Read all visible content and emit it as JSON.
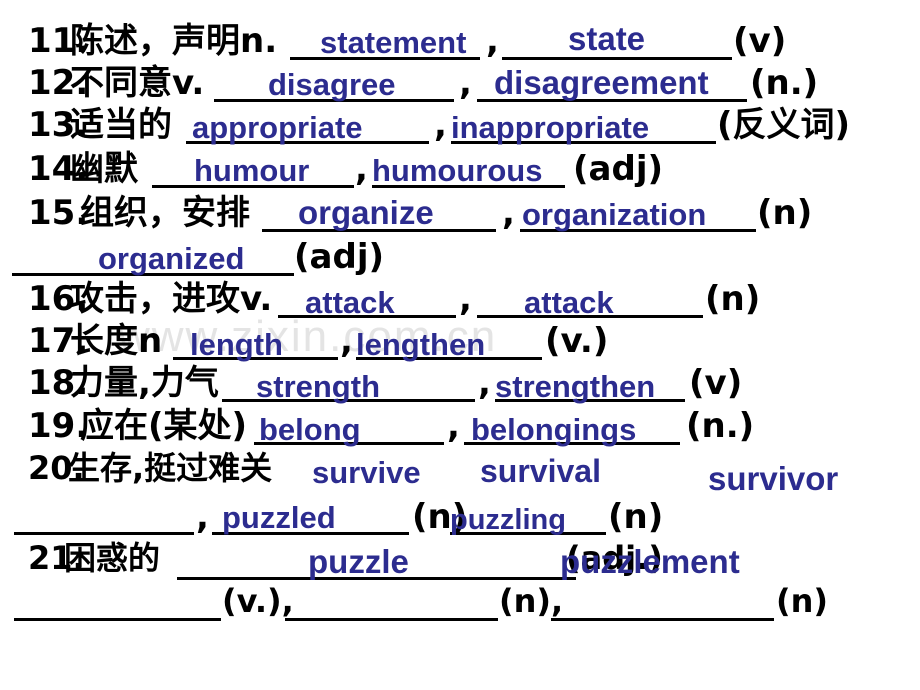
{
  "slide": {
    "background_color": "#ffffff",
    "answer_color": "#2c2c8f",
    "text_color": "#000000",
    "watermark": "www.zixin.com.cn",
    "watermark_color": "#e4e4e4"
  },
  "entries": [
    {
      "number": "11.",
      "prompt": "陈述，声明n.",
      "answers": [
        "statement",
        "state"
      ],
      "tags": [
        "(v)"
      ],
      "separator": ","
    },
    {
      "number": "12.",
      "prompt": "不同意v.",
      "answers": [
        "disagree",
        "disagreement"
      ],
      "tags": [
        "(n.)"
      ],
      "separator": ","
    },
    {
      "number": "13.",
      "prompt": "适当的",
      "answers": [
        "appropriate",
        "inappropriate"
      ],
      "tags": [
        "(反义词)"
      ],
      "separator": ","
    },
    {
      "number": "14.",
      "prompt": "幽默",
      "answers": [
        "humour",
        "humourous"
      ],
      "tags": [
        "(adj)"
      ],
      "separator": ","
    },
    {
      "number": "15.",
      "prompt": "组织，安排",
      "answers": [
        "organize",
        "organization",
        "organized"
      ],
      "tags": [
        "(n)",
        "(adj)"
      ],
      "separator": ","
    },
    {
      "number": "16.",
      "prompt": "攻击，进攻v.",
      "answers": [
        "attack",
        "attack"
      ],
      "tags": [
        "(n)"
      ],
      "separator": ","
    },
    {
      "number": "17.",
      "prompt": "长度n",
      "answers": [
        "length",
        "lengthen"
      ],
      "tags": [
        "(v.)"
      ],
      "separator": ","
    },
    {
      "number": "18.",
      "prompt": "力量,力气",
      "answers": [
        "strength",
        "strengthen"
      ],
      "tags": [
        "(v)"
      ],
      "separator": ","
    },
    {
      "number": "19.",
      "prompt": "应在(某处)",
      "answers": [
        "belong",
        "belongings"
      ],
      "tags": [
        "(n.)"
      ],
      "separator": ","
    },
    {
      "number": "20.",
      "prompt": "生存,挺过难关",
      "answers": [
        "survive",
        "survival",
        "survivor",
        "puzzled",
        "puzzling"
      ],
      "tags": [
        "(n)",
        "(n)"
      ],
      "separator": ","
    },
    {
      "number": "21.",
      "prompt": "困惑的",
      "answers": [
        "puzzle",
        "puzzlement"
      ],
      "tags": [
        "(adj.)",
        "(v.),",
        "(n),",
        "(n)"
      ],
      "separator": ","
    }
  ],
  "line11": {
    "num": "11.",
    "prompt": "陈述，声明n.",
    "a1": "statement",
    "comma": ",",
    "a2": "state",
    "tag": "(v)"
  },
  "line12": {
    "num": "12.",
    "prompt": "不同意v.",
    "a1": "disagree",
    "comma": ",",
    "a2": "disagreement",
    "tag": "(n.)"
  },
  "line13": {
    "num": "13.",
    "prompt": "适当的",
    "a1": "appropriate",
    "comma": ",",
    "a2": "inappropriate",
    "tag": "(反义词)"
  },
  "line14": {
    "num": "14.",
    "prompt": "幽默",
    "a1": "humour",
    "comma": ",",
    "a2": "humourous",
    "tag": "(adj)"
  },
  "line15": {
    "num": "15.",
    "prompt": "组织，安排",
    "a1": "organize",
    "comma": ",",
    "a2": "organization",
    "tag1": "(n)",
    "a3": "organized",
    "tag2": "(adj)"
  },
  "line16": {
    "num": "16.",
    "prompt": "攻击，进攻v.",
    "a1": "attack",
    "comma": ",",
    "a2": "attack",
    "tag": "(n)"
  },
  "line17": {
    "num": "17.",
    "prompt": "长度n",
    "a1": "length",
    "comma": ",",
    "a2": "lengthen",
    "tag": "(v.)"
  },
  "line18": {
    "num": "18.",
    "prompt": "力量,力气",
    "a1": "strength",
    "comma": ",",
    "a2": "strengthen",
    "tag": "(v)"
  },
  "line19": {
    "num": "19.",
    "prompt": "应在(某处)",
    "a1": "belong",
    "comma": ",",
    "a2": "belongings",
    "tag": "(n.)"
  },
  "line20": {
    "num": "20.",
    "prompt": "生存,挺过难关",
    "a1": "survive",
    "a2": "survival",
    "a3": "survivor",
    "comma": ",",
    "a4": "puzzled",
    "tag1": "(n)",
    "a5": "puzzling",
    "tag2": "(n)"
  },
  "line21": {
    "num": "21.",
    "prompt": "困惑的",
    "a1": "puzzle",
    "a2": "puzzlement",
    "tag1": "(adj.)",
    "tag2": "(v.),",
    "tag3": "(n),",
    "tag4": "(n)"
  }
}
